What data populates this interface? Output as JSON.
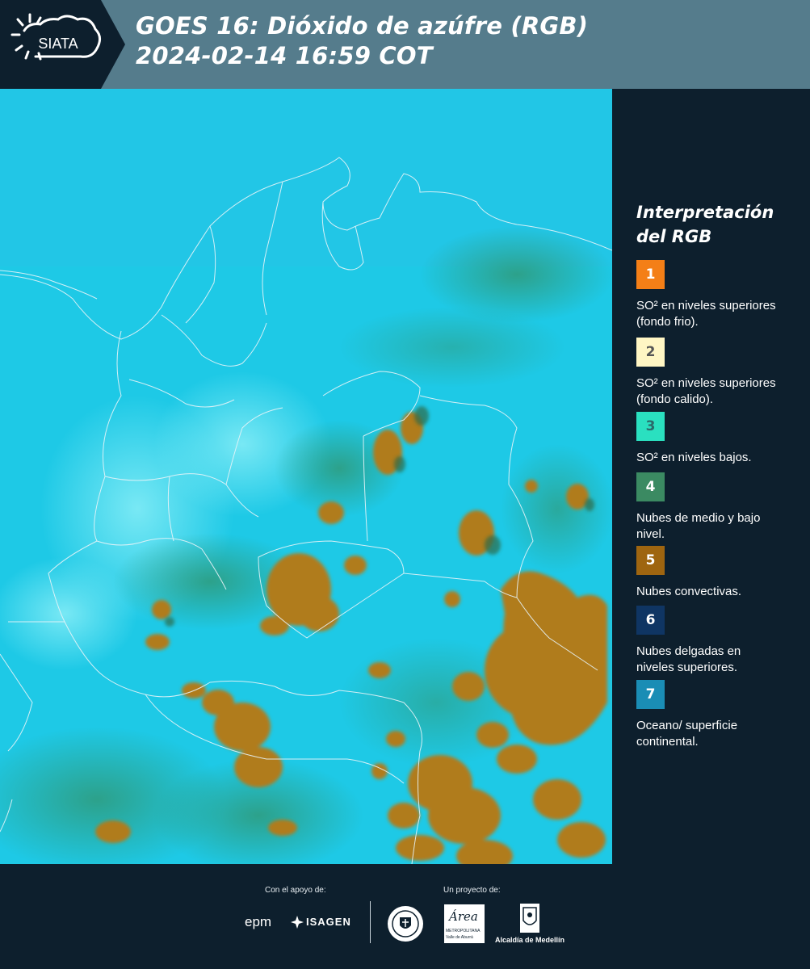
{
  "header": {
    "logo_text": "SIATA",
    "title_line1": "GOES 16: Dióxido de azúfre (RGB)",
    "title_line2": " 2024-02-14 16:59 COT"
  },
  "legend": {
    "title_line1": "Interpretación",
    "title_line2": "del RGB",
    "items": [
      {
        "number": "1",
        "color": "#f47f17",
        "text_color": "#ffffff",
        "label": "SO² en niveles superiores (fondo frio)."
      },
      {
        "number": "2",
        "color": "#fff6c4",
        "text_color": "#555555",
        "label": "SO² en niveles superiores (fondo calido)."
      },
      {
        "number": "3",
        "color": "#2ae0c0",
        "text_color": "#2a6a6a",
        "label": "SO² en niveles bajos."
      },
      {
        "number": "4",
        "color": "#3b8a62",
        "text_color": "#ffffff",
        "label": "Nubes de medio y bajo nivel."
      },
      {
        "number": "5",
        "color": "#9e6510",
        "text_color": "#ffffff",
        "label": "Nubes convectivas."
      },
      {
        "number": "6",
        "color": "#0f3563",
        "text_color": "#ffffff",
        "label": "Nubes delgadas en niveles superiores."
      },
      {
        "number": "7",
        "color": "#1a8db5",
        "text_color": "#ffffff",
        "label": "Oceano/ superficie continental."
      }
    ]
  },
  "footer": {
    "support_label": "Con el apoyo de:",
    "project_label": "Un proyecto de:",
    "sponsor_epm": "epm",
    "sponsor_isagen": "ISAGEN",
    "partner_area": "Área",
    "partner_area_sub1": "METROPOLITANA",
    "partner_area_sub2": "Valle de Aburrá",
    "partner_alcaldia": "Alcaldía de Medellín"
  },
  "colors": {
    "header_bg": "#557c8c",
    "dark_bg": "#0d1f2d",
    "map_cyan": "#1ec9e6",
    "cloud_convective": "#b07c1e"
  }
}
